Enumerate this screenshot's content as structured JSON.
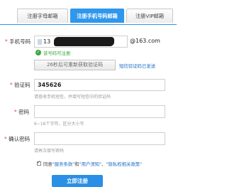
{
  "tabs": [
    {
      "label": "注册字母邮箱"
    },
    {
      "label": "注册手机号码邮箱"
    },
    {
      "label": "注册VIP邮箱"
    }
  ],
  "phone": {
    "label": "手机号码",
    "value": "13",
    "suffix": "@163.com",
    "ok_text": "该号码可注册"
  },
  "code_button": {
    "label": "26秒后可重新获取验证码",
    "sent_text": "短信验证码已发送"
  },
  "sms": {
    "label": "验证码",
    "value": "345626",
    "hint": "请查收手机短信，并填写短信中的验证码"
  },
  "password": {
    "label": "密码",
    "hint": "6~16个字符，区分大小写"
  },
  "confirm": {
    "label": "确认密码",
    "hint": "请再次填写密码"
  },
  "agreement": {
    "prefix": "同意",
    "terms": "\"服务条款\"",
    "and": "和",
    "notice": "\"用户须知\"",
    "sep": "、",
    "privacy": "\"隐私权相关政策\""
  },
  "submit_label": "立即注册",
  "colors": {
    "accent": "#2f97ec",
    "ok": "#3aa63a",
    "required": "#e64b3b"
  }
}
